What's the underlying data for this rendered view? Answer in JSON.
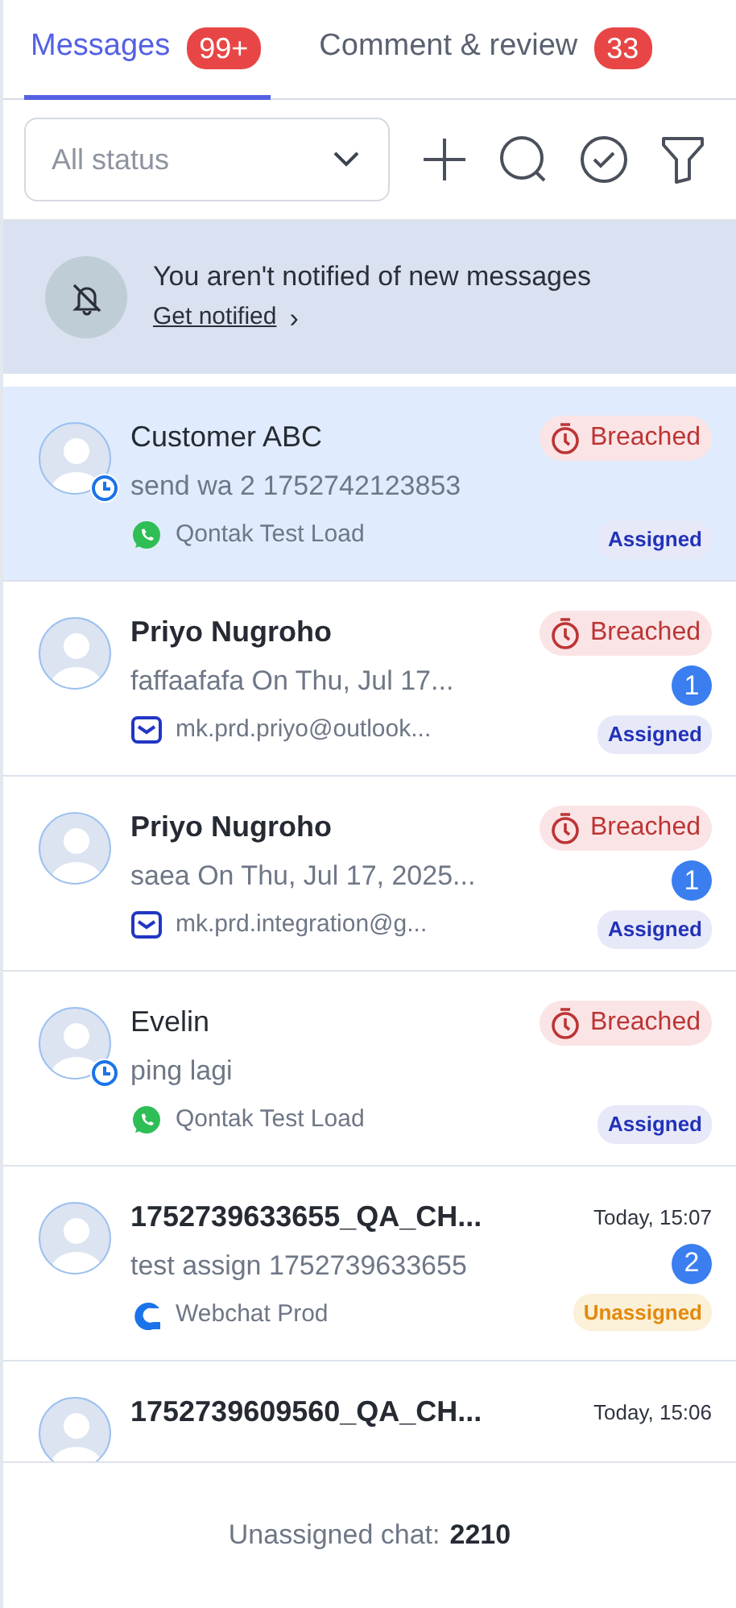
{
  "tabs": [
    {
      "label": "Messages",
      "count": "99+",
      "selected": true
    },
    {
      "label": "Comment & review",
      "count": "33",
      "selected": false
    }
  ],
  "filter": {
    "placeholder": "All status"
  },
  "banner": {
    "text": "You aren't notified of new messages",
    "link": "Get notified",
    "chevron": "›"
  },
  "conversations": [
    {
      "name": "Customer ABC",
      "unread": false,
      "selected": true,
      "waiting": true,
      "preview": "send wa 2 1752742123853",
      "sla": {
        "kind": "breached",
        "label": "Breached"
      },
      "channel": {
        "kind": "whatsapp",
        "label": "Qontak Test Load"
      },
      "assignment": {
        "kind": "assigned",
        "label": "Assigned"
      }
    },
    {
      "name": "Priyo Nugroho",
      "unread": true,
      "selected": false,
      "waiting": false,
      "preview": "faffaafafa On Thu, Jul 17...",
      "sla": {
        "kind": "breached",
        "label": "Breached"
      },
      "count": "1",
      "channel": {
        "kind": "email",
        "label": "mk.prd.priyo@outlook..."
      },
      "assignment": {
        "kind": "assigned",
        "label": "Assigned"
      }
    },
    {
      "name": "Priyo Nugroho",
      "unread": true,
      "selected": false,
      "waiting": false,
      "preview": "saea On Thu, Jul 17, 2025...",
      "sla": {
        "kind": "breached",
        "label": "Breached"
      },
      "count": "1",
      "channel": {
        "kind": "email",
        "label": "mk.prd.integration@g..."
      },
      "assignment": {
        "kind": "assigned",
        "label": "Assigned"
      }
    },
    {
      "name": "Evelin",
      "unread": false,
      "selected": false,
      "waiting": true,
      "preview": "ping lagi",
      "sla": {
        "kind": "breached",
        "label": "Breached"
      },
      "channel": {
        "kind": "whatsapp",
        "label": "Qontak Test Load"
      },
      "assignment": {
        "kind": "assigned",
        "label": "Assigned"
      }
    },
    {
      "name": "1752739633655_QA_CH...",
      "unread": true,
      "selected": false,
      "waiting": false,
      "preview": "test assign 1752739633655",
      "sla": {
        "kind": "time",
        "label": "Today, 15:07"
      },
      "count": "2",
      "channel": {
        "kind": "webchat",
        "label": "Webchat Prod"
      },
      "assignment": {
        "kind": "unassigned",
        "label": "Unassigned"
      }
    },
    {
      "name": "1752739609560_QA_CH...",
      "unread": true,
      "selected": false,
      "waiting": false,
      "sla": {
        "kind": "time",
        "label": "Today, 15:06"
      }
    }
  ],
  "footer": {
    "label": "Unassigned chat:",
    "value": "2210"
  }
}
